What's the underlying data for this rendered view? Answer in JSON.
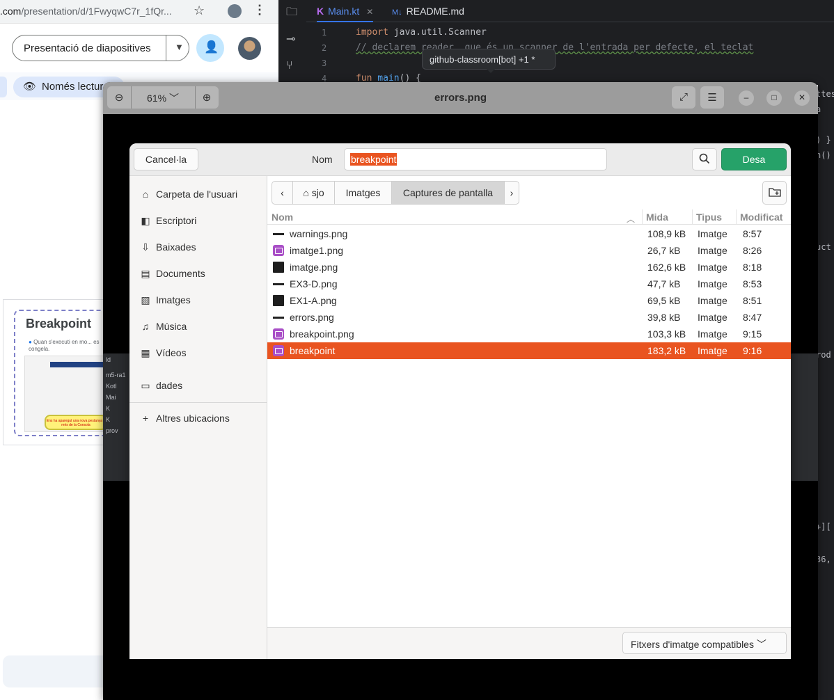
{
  "chrome": {
    "url_main": ".com",
    "url_rest": "/presentation/d/1FwyqwC7r_1fQr...",
    "slideshow_button": "Presentació de diapositives",
    "readonly_chip": "Només lectura",
    "thumbnail": {
      "title": "Breakpoint",
      "bullet": "Quan s'executi en mo... es congela.",
      "note": "Ens ha aparegut una nova pestanya a més de la Consola"
    }
  },
  "ide": {
    "tabs": [
      {
        "label": "Main.kt",
        "prefix": "K"
      },
      {
        "label": "README.md",
        "prefix": "M↓"
      }
    ],
    "line_numbers": [
      "1",
      "2",
      "3",
      "4"
    ],
    "code": {
      "line1_kw": "import",
      "line1_rest": " java.util.Scanner",
      "line2": "// declarem reader, que és un scanner de l'entrada per defecte, el teclat",
      "line4_kw": "fun",
      "line4_fn": " main",
      "line4_rest": "() {"
    },
    "tooltip": "github-classroom[bot] +1 *",
    "right_peek": [
      "ttes",
      "a",
      ") }",
      "n()",
      "uct",
      "rod",
      "+][",
      "36,"
    ]
  },
  "viewer": {
    "title": "errors.png",
    "zoom": "61%",
    "snippet_lines": [
      "ld",
      "m5-ra1",
      "Kotl",
      "Mai",
      "K",
      "K",
      "prov"
    ]
  },
  "dialog": {
    "cancel_label": "Cancel·la",
    "name_label": "Nom",
    "filename": "breakpoint",
    "save_label": "Desa",
    "places": [
      {
        "icon": "home-icon",
        "label": "Carpeta de l'usuari"
      },
      {
        "icon": "desktop-icon",
        "label": "Escriptori"
      },
      {
        "icon": "download-icon",
        "label": "Baixades"
      },
      {
        "icon": "document-icon",
        "label": "Documents"
      },
      {
        "icon": "image-icon",
        "label": "Imatges"
      },
      {
        "icon": "music-icon",
        "label": "Música"
      },
      {
        "icon": "video-icon",
        "label": "Vídeos"
      },
      {
        "icon": "folder-icon",
        "label": "dades"
      },
      {
        "icon": "plus-icon",
        "label": "Altres ubicacions"
      }
    ],
    "path": [
      "sjo",
      "Imatges",
      "Captures de pantalla"
    ],
    "columns": {
      "name": "Nom",
      "size": "Mida",
      "type": "Tipus",
      "modified": "Modificat"
    },
    "files": [
      {
        "name": "warnings.png",
        "size": "108,9 kB",
        "type": "Imatge",
        "modified": "8:57",
        "icon": "dash"
      },
      {
        "name": "imatge1.png",
        "size": "26,7 kB",
        "type": "Imatge",
        "modified": "8:26",
        "icon": "purple"
      },
      {
        "name": "imatge.png",
        "size": "162,6 kB",
        "type": "Imatge",
        "modified": "8:18",
        "icon": "dark"
      },
      {
        "name": "EX3-D.png",
        "size": "47,7 kB",
        "type": "Imatge",
        "modified": "8:53",
        "icon": "dash"
      },
      {
        "name": "EX1-A.png",
        "size": "69,5 kB",
        "type": "Imatge",
        "modified": "8:51",
        "icon": "dark"
      },
      {
        "name": "errors.png",
        "size": "39,8 kB",
        "type": "Imatge",
        "modified": "8:47",
        "icon": "dash"
      },
      {
        "name": "breakpoint.png",
        "size": "103,3 kB",
        "type": "Imatge",
        "modified": "9:15",
        "icon": "purple"
      },
      {
        "name": "breakpoint",
        "size": "183,2 kB",
        "type": "Imatge",
        "modified": "9:16",
        "icon": "purple",
        "selected": true
      }
    ],
    "filter": "Fitxers d'imatge compatibles"
  },
  "colors": {
    "accent": "#e95420",
    "save": "#26a269"
  }
}
